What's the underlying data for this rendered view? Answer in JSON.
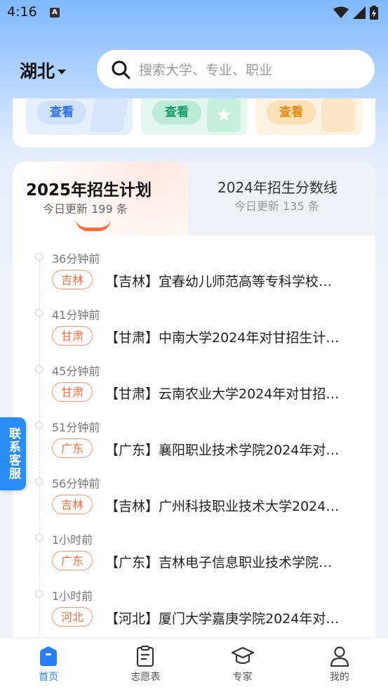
{
  "status_bar": {
    "time": "4:16",
    "notification_icon": "A"
  },
  "header": {
    "region": "湖北",
    "search_placeholder": "搜索大学、专业、职业"
  },
  "top_cards": [
    {
      "button": "查看",
      "accent": "#2f6ee8"
    },
    {
      "button": "查看",
      "accent": "#179a6b"
    },
    {
      "button": "查看",
      "accent": "#e58a13"
    }
  ],
  "tabs": {
    "active": {
      "title": "2025年招生计划",
      "subtitle": "今日更新 199 条"
    },
    "inactive": {
      "title": "2024年招生分数线",
      "subtitle": "今日更新 135 条"
    }
  },
  "feed": [
    {
      "time": "36分钟前",
      "tag": "吉林",
      "text": "【吉林】宜春幼儿师范高等专科学校…"
    },
    {
      "time": "41分钟前",
      "tag": "甘肃",
      "text": "【甘肃】中南大学2024年对甘招生计…"
    },
    {
      "time": "45分钟前",
      "tag": "甘肃",
      "text": "【甘肃】云南农业大学2024年对甘招…"
    },
    {
      "time": "51分钟前",
      "tag": "广东",
      "text": "【广东】襄阳职业技术学院2024年对…"
    },
    {
      "time": "56分钟前",
      "tag": "吉林",
      "text": "【吉林】广州科技职业技术大学2024…"
    },
    {
      "time": "1小时前",
      "tag": "广东",
      "text": "【广东】吉林电子信息职业技术学院…"
    },
    {
      "time": "1小时前",
      "tag": "河北",
      "text": "【河北】厦门大学嘉庚学院2024年对…"
    }
  ],
  "contact": "联系客服",
  "nav": [
    {
      "label": "首页",
      "icon": "home-icon",
      "active": true
    },
    {
      "label": "志愿表",
      "icon": "clipboard-icon",
      "active": false
    },
    {
      "label": "专家",
      "icon": "graduation-cap-icon",
      "active": false
    },
    {
      "label": "我的",
      "icon": "user-icon",
      "active": false
    }
  ],
  "colors": {
    "accent": "#2a7ef5",
    "tag": "#ff6a3d"
  }
}
